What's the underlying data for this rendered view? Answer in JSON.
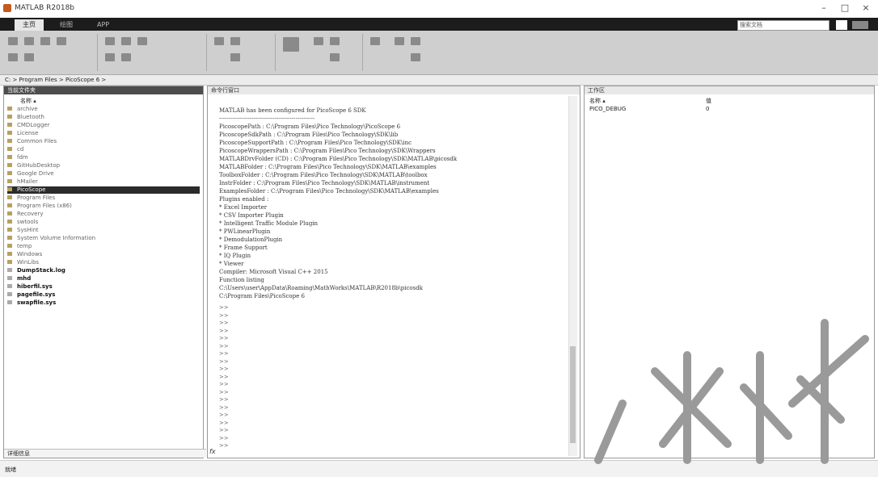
{
  "window": {
    "title": "MATLAB R2018b"
  },
  "tabs": [
    "主页",
    "绘图",
    "APP"
  ],
  "search": {
    "placeholder": "搜索文档"
  },
  "address": {
    "path": "C: > Program Files > PicoScope 6 >"
  },
  "folder_panel": {
    "title": "当前文件夹",
    "header": "名称 ▴",
    "items": [
      {
        "name": "archive",
        "kind": "folder"
      },
      {
        "name": "Bluetooth",
        "kind": "folder"
      },
      {
        "name": "CMDLogger",
        "kind": "folder"
      },
      {
        "name": "License",
        "kind": "folder"
      },
      {
        "name": "Common Files",
        "kind": "folder"
      },
      {
        "name": "cd",
        "kind": "folder"
      },
      {
        "name": "fdm",
        "kind": "folder"
      },
      {
        "name": "GitHubDesktop",
        "kind": "folder"
      },
      {
        "name": "Google Drive",
        "kind": "folder"
      },
      {
        "name": "hMailer",
        "kind": "folder"
      },
      {
        "name": "PicoScope",
        "kind": "folder",
        "selected": true
      },
      {
        "name": "Program Files",
        "kind": "folder"
      },
      {
        "name": "Program Files (x86)",
        "kind": "folder"
      },
      {
        "name": "Recovery",
        "kind": "folder"
      },
      {
        "name": "swtools",
        "kind": "folder"
      },
      {
        "name": "SysHint",
        "kind": "folder"
      },
      {
        "name": "System Volume Information",
        "kind": "folder"
      },
      {
        "name": "temp",
        "kind": "folder"
      },
      {
        "name": "Windows",
        "kind": "folder"
      },
      {
        "name": "WinLibs",
        "kind": "folder"
      },
      {
        "name": "DumpStack.log",
        "kind": "file",
        "bold": true
      },
      {
        "name": "mhd",
        "kind": "file",
        "bold": true
      },
      {
        "name": "hiberfil.sys",
        "kind": "file",
        "bold": true
      },
      {
        "name": "pagefile.sys",
        "kind": "file",
        "bold": true
      },
      {
        "name": "swapfile.sys",
        "kind": "file",
        "bold": true
      }
    ],
    "details_label": "详细信息"
  },
  "command_panel": {
    "title": "命令行窗口",
    "lines": [
      "MATLAB has been configured for PicoScope 6 SDK",
      "--------------------------------------------------",
      "PicoscopePath : C:\\Program Files\\Pico Technology\\PicoScope 6",
      "PicoscopeSdkPath : C:\\Program Files\\Pico Technology\\SDK\\lib",
      "PicoscopeSupportPath : C:\\Program Files\\Pico Technology\\SDK\\inc",
      "PicoscopeWrappersPath : C:\\Program Files\\Pico Technology\\SDK\\Wrappers",
      "MATLABDrvFolder (CD) : C:\\Program Files\\Pico Technology\\SDK\\MATLAB\\picosdk",
      "MATLABFolder : C:\\Program Files\\Pico Technology\\SDK\\MATLAB\\examples",
      "ToolboxFolder : C:\\Program Files\\Pico Technology\\SDK\\MATLAB\\toolbox",
      "InstrFolder : C:\\Program Files\\Pico Technology\\SDK\\MATLAB\\instrument",
      "ExamplesFolder : C:\\Program Files\\Pico Technology\\SDK\\MATLAB\\examples",
      "Plugins enabled :",
      "  * Excel Importer",
      "  * CSV Importer Plugin",
      "  * Intelligent Traffic Module Plugin",
      "  * PWLinearPlugin",
      "  * DemodulationPlugin",
      "  * Frame Support",
      "  * IQ Plugin",
      "  * Viewer",
      "Compiler: Microsoft Visual C++ 2015",
      "Function listing",
      "  C:\\Users\\user\\AppData\\Roaming\\MathWorks\\MATLAB\\R2018b\\picosdk",
      "  C:\\Program Files\\PicoScope 6"
    ],
    "prompts": [
      ">>",
      ">>",
      ">>",
      ">>",
      ">>",
      ">>",
      ">>",
      ">>",
      ">>",
      ">>",
      ">>",
      ">>",
      ">>",
      ">>",
      ">>",
      ">>",
      ">>",
      ">>",
      ">>"
    ],
    "fx": "fx"
  },
  "workspace_panel": {
    "title": "工作区",
    "col_name": "名称 ▴",
    "col_value": "值",
    "rows": [
      {
        "name": "PICO_DEBUG",
        "value": "0"
      }
    ]
  },
  "status": {
    "text": "就绪"
  },
  "watermark": {
    "text": "出版社"
  }
}
